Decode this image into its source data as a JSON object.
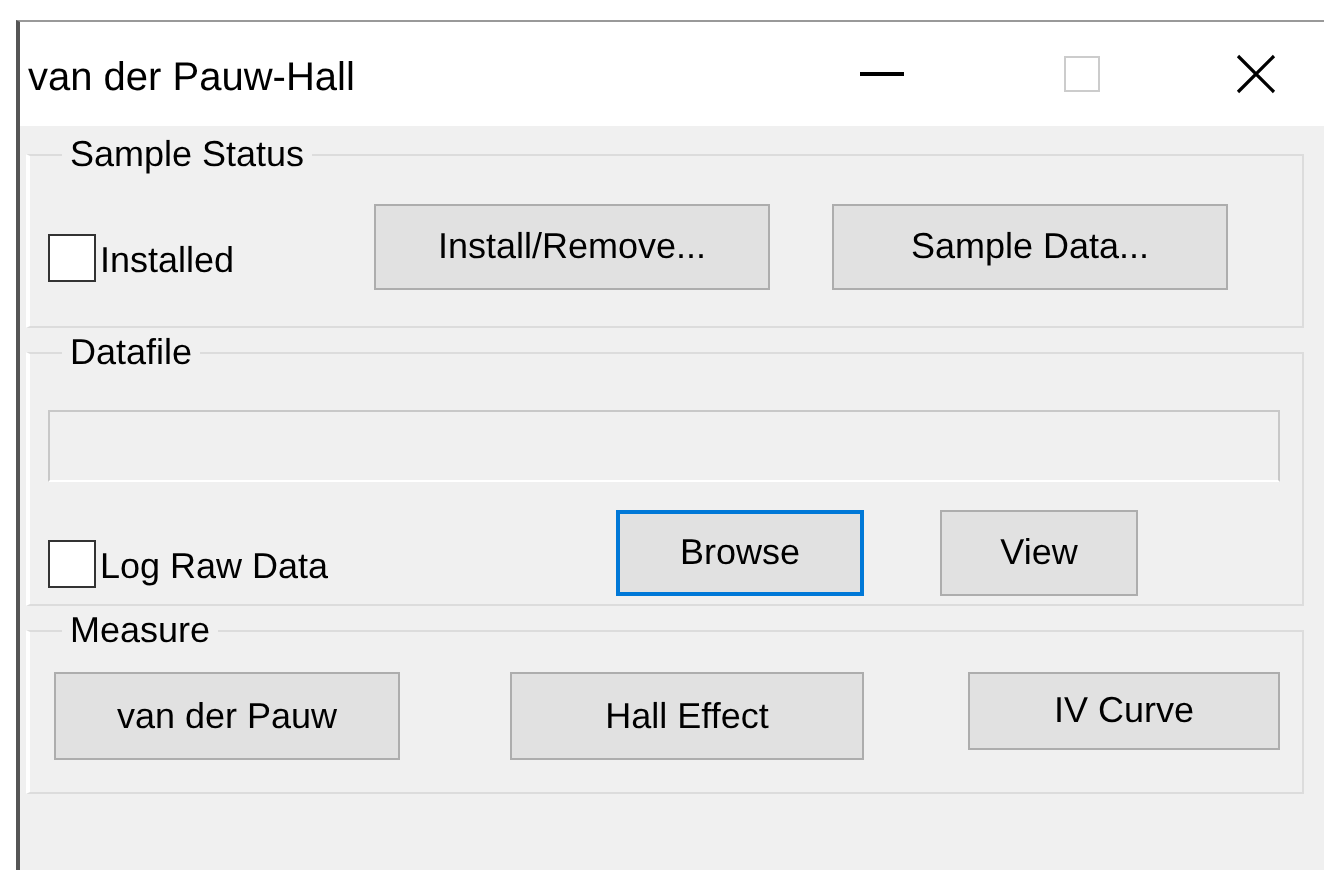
{
  "window": {
    "title": "van der Pauw-Hall"
  },
  "groups": [
    {
      "kind": "sample_status",
      "title": "Sample Status",
      "checkbox": {
        "label": "Installed",
        "checked": false
      },
      "buttons": [
        {
          "label": "Install/Remove...",
          "focused": false
        },
        {
          "label": "Sample Data...",
          "focused": false
        }
      ]
    },
    {
      "kind": "datafile",
      "title": "Datafile",
      "field": {
        "disabled": true
      },
      "checkbox": {
        "label": "Log Raw Data",
        "checked": false
      },
      "buttons": [
        {
          "label": "Browse",
          "focused": true
        },
        {
          "label": "View",
          "focused": false
        }
      ]
    },
    {
      "kind": "measure",
      "title": "Measure",
      "buttons": [
        {
          "label": "van der Pauw",
          "focused": false
        },
        {
          "label": "Hall Effect",
          "focused": false
        },
        {
          "label": "IV Curve",
          "focused": false
        }
      ]
    }
  ]
}
